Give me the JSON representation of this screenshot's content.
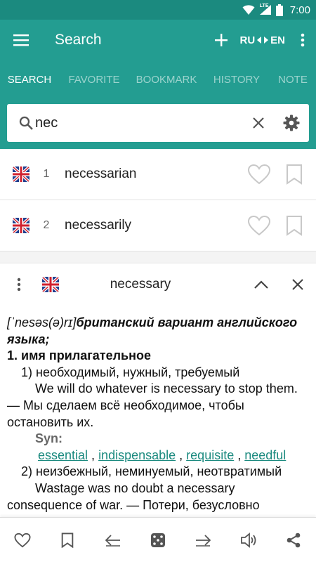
{
  "status_bar": {
    "time": "7:00",
    "network": "LTE"
  },
  "appbar": {
    "title": "Search",
    "lang_from": "RU",
    "lang_to": "EN"
  },
  "tabs": [
    {
      "label": "SEARCH",
      "active": true
    },
    {
      "label": "FAVORITE",
      "active": false
    },
    {
      "label": "BOOKMARK",
      "active": false
    },
    {
      "label": "HISTORY",
      "active": false
    },
    {
      "label": "NOTE",
      "active": false
    }
  ],
  "search": {
    "value": "nec"
  },
  "results": [
    {
      "num": "1",
      "word": "necessarian"
    },
    {
      "num": "2",
      "word": "necessarily"
    }
  ],
  "card": {
    "title": "necessary",
    "entry": {
      "transcription": "[ˈnesəs(ə)rɪ]",
      "variant": "британский вариант английского языка;",
      "pos": "1. имя прилагательное",
      "sense1": "1) необходимый, нужный, требуемый",
      "example1": "We will do whatever is necessary to stop them. — Мы сделаем всё необходимое, чтобы остановить их.",
      "syn_label": "Syn:",
      "synonyms": [
        "essential",
        "indispensable",
        "requisite",
        "needful"
      ],
      "sense2": "2) неизбежный, неминуемый, неотвратимый",
      "example2": "Wastage was no doubt a necessary consequence of war. — Потери, безусловно"
    }
  },
  "colors": {
    "primary": "#239d91",
    "primary_dark": "#1b8a7f",
    "link": "#1b8a7f"
  }
}
